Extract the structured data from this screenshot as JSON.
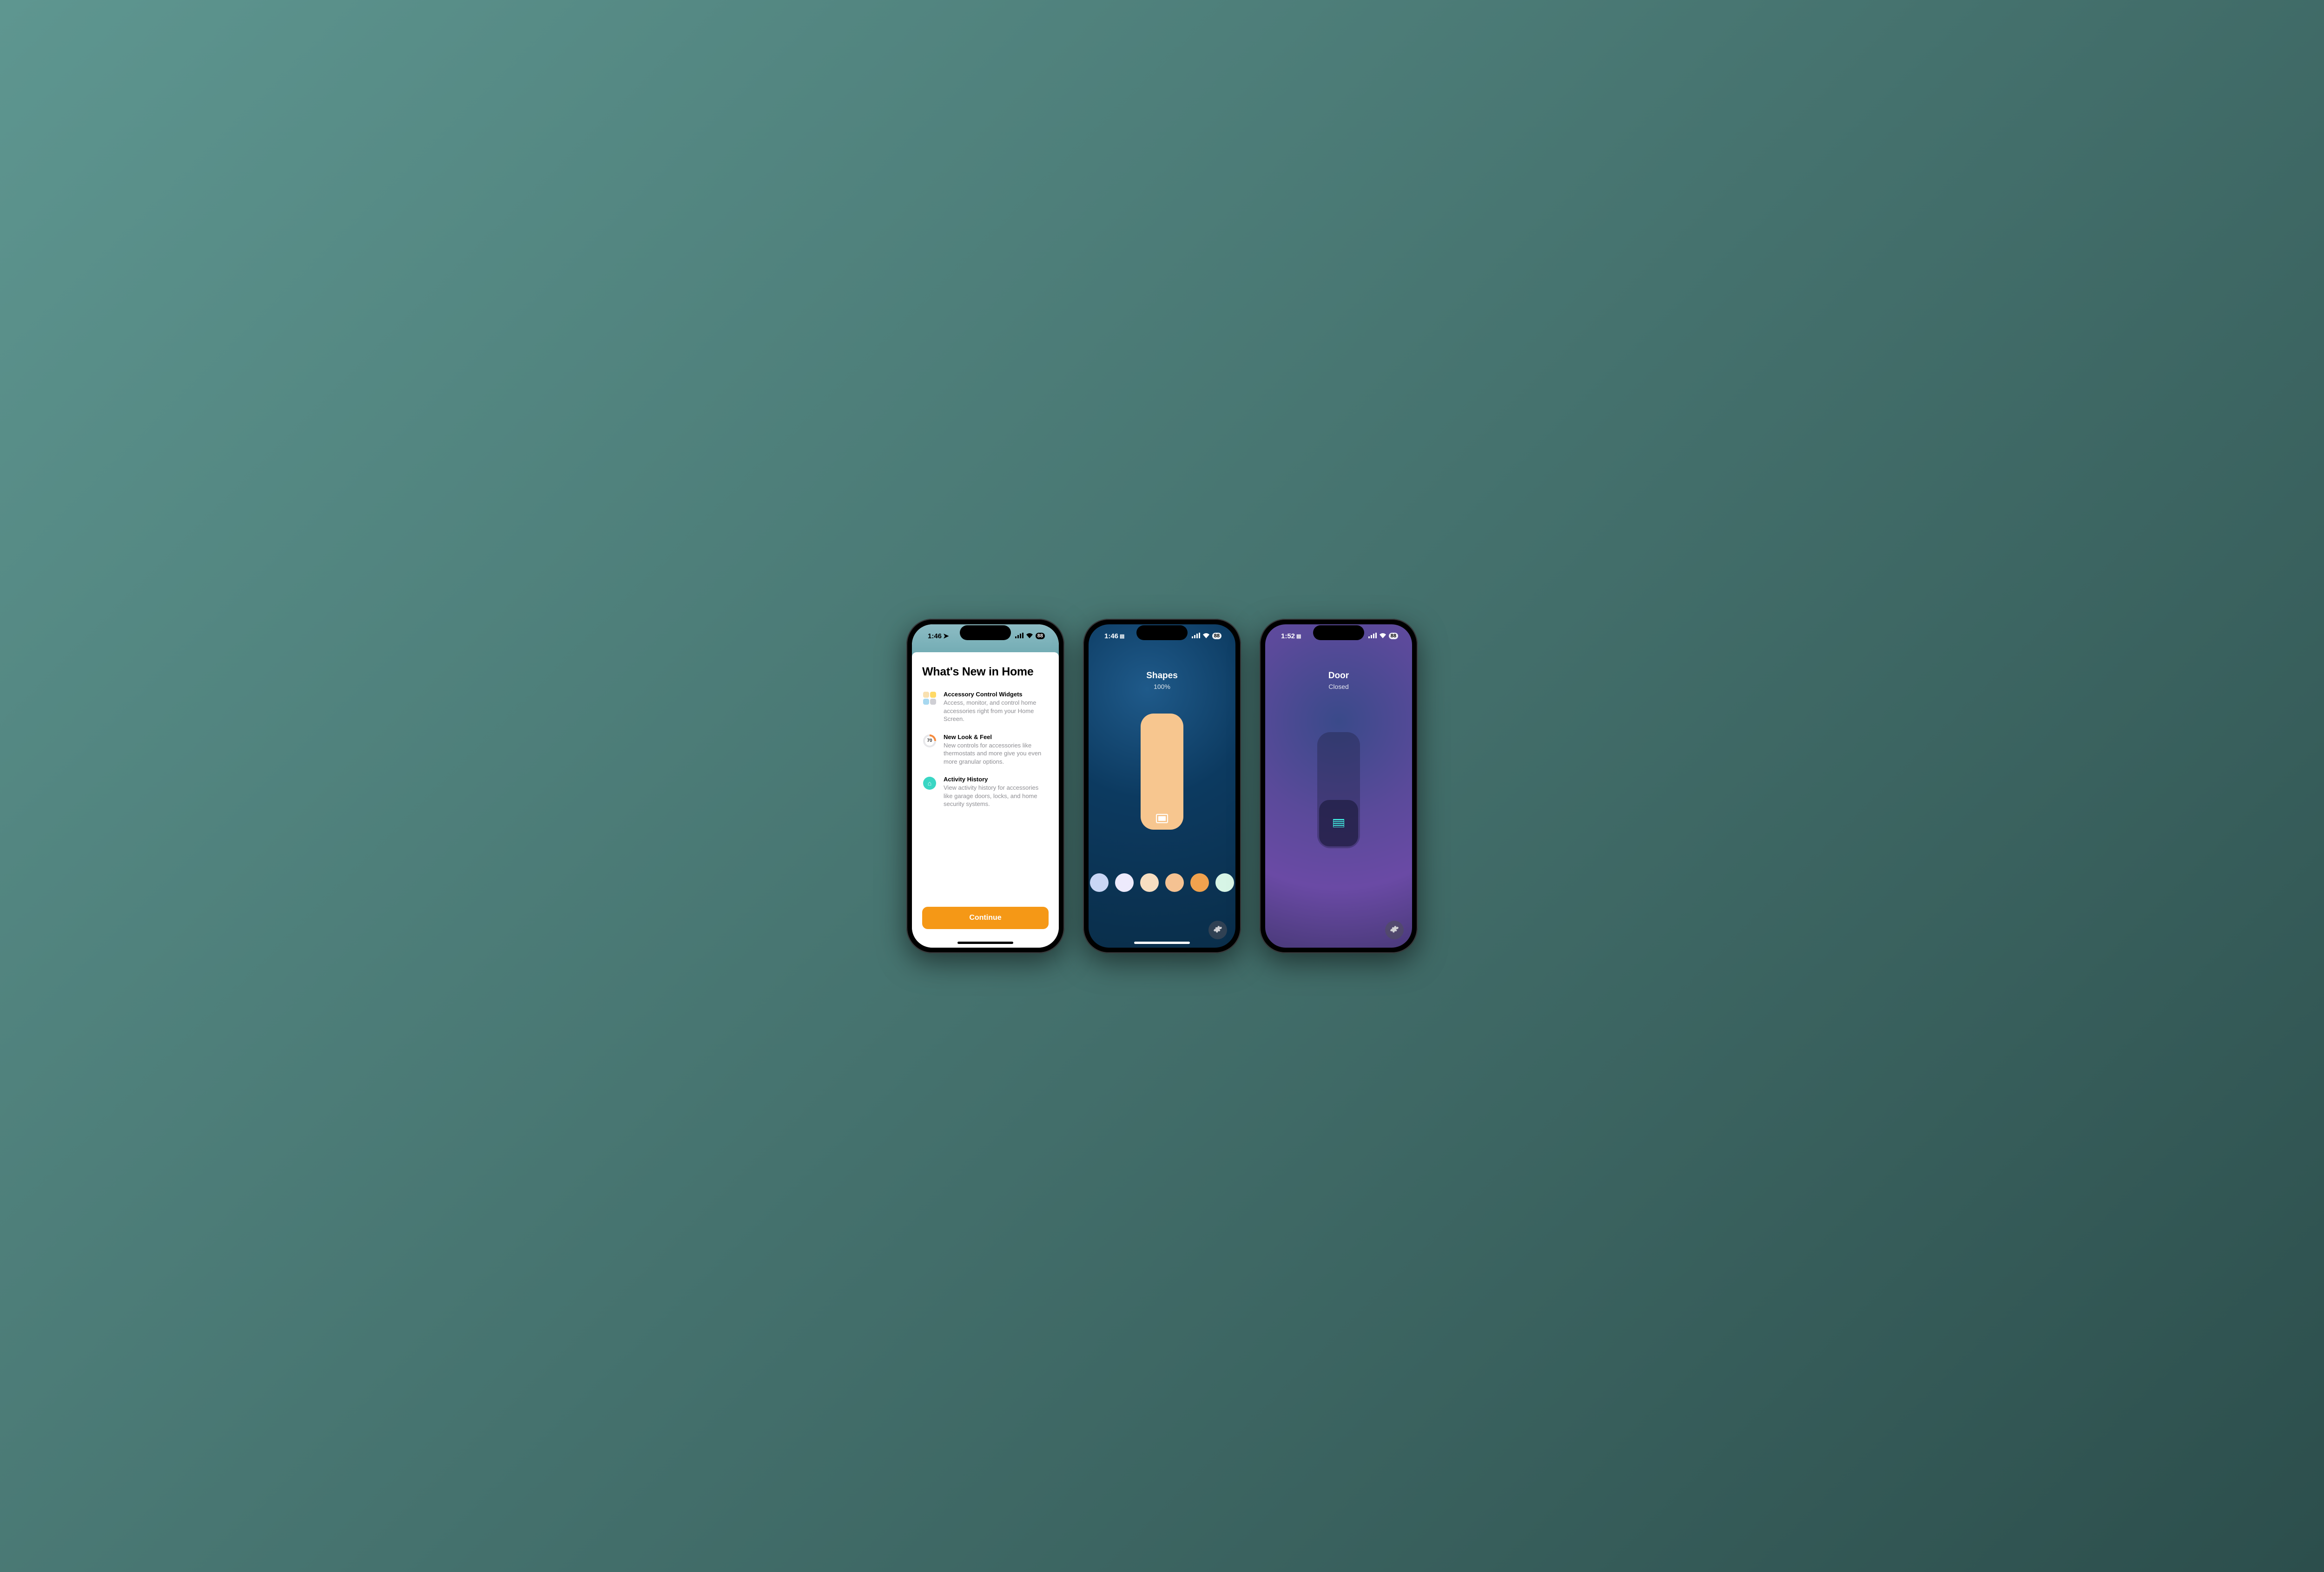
{
  "phone1": {
    "status": {
      "time": "1:46",
      "loc_icon": "location-icon",
      "battery": "88"
    },
    "title": "What's New in Home",
    "features": [
      {
        "title": "Accessory Control Widgets",
        "desc": "Access, monitor, and control home accessories right from your Home Screen."
      },
      {
        "title": "New Look & Feel",
        "thermo_value": "70",
        "desc": "New controls for accessories like thermostats and more give you even more granular options."
      },
      {
        "title": "Activity History",
        "desc": "View activity history for accessories like garage doors, locks, and home security systems."
      }
    ],
    "continue_label": "Continue"
  },
  "phone2": {
    "status": {
      "time": "1:46",
      "battery": "88"
    },
    "title": "Shapes",
    "subtitle": "100%",
    "swatches": [
      "#c9d6f5",
      "#edeafc",
      "#f7dec1",
      "#f5c292",
      "#f0a24e",
      "#d7f5e6"
    ]
  },
  "phone3": {
    "status": {
      "time": "1:52",
      "battery": "88"
    },
    "title": "Door",
    "subtitle": "Closed"
  }
}
